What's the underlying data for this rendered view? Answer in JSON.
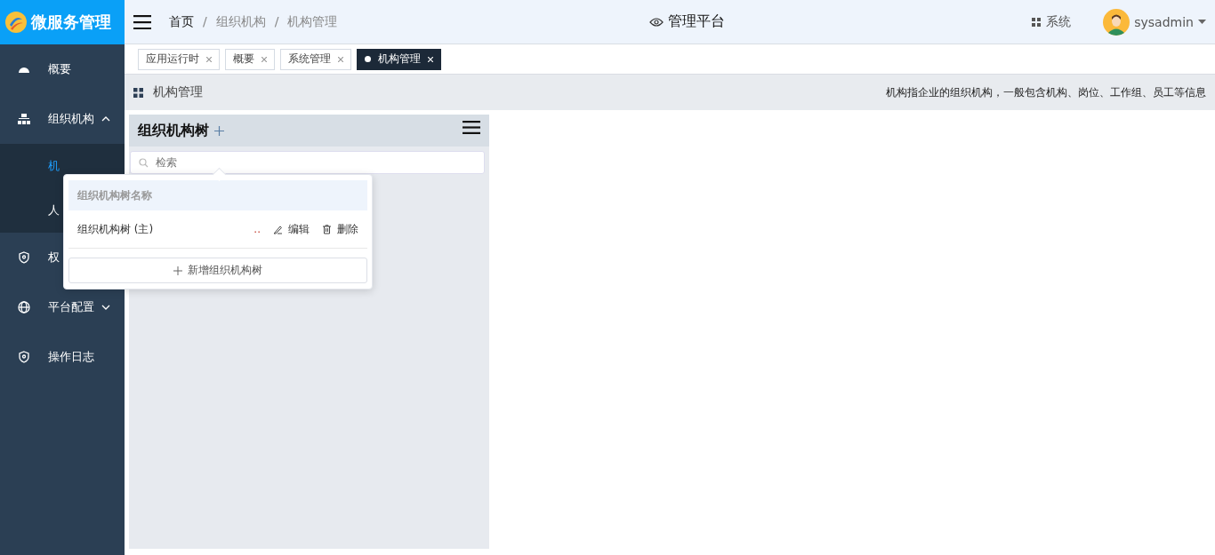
{
  "logo": {
    "title": "微服务管理"
  },
  "breadcrumb": {
    "separator": "/",
    "items": [
      {
        "label": "首页",
        "current": false
      },
      {
        "label": "组织机构",
        "current": true
      },
      {
        "label": "机构管理",
        "current": true
      }
    ]
  },
  "header": {
    "platform": "管理平台",
    "system": "系统",
    "user": "sysadmin"
  },
  "sidebar": {
    "items": [
      {
        "label": "概要"
      },
      {
        "label": "组织机构",
        "expanded": true,
        "children": [
          {
            "label": "机",
            "selected": true
          },
          {
            "label": "人",
            "selected": false
          }
        ]
      },
      {
        "label": "权"
      },
      {
        "label": "平台配置",
        "expanded": false
      },
      {
        "label": "操作日志"
      }
    ]
  },
  "tabs": [
    {
      "label": "应用运行时",
      "selected": false
    },
    {
      "label": "概要",
      "selected": false
    },
    {
      "label": "系统管理",
      "selected": false
    },
    {
      "label": "机构管理",
      "selected": true
    }
  ],
  "page": {
    "title": "机构管理",
    "description": "机构指企业的组织机构，一般包含机构、岗位、工作组、员工等信息"
  },
  "tree_panel": {
    "title": "组织机构树",
    "search_placeholder": "检索"
  },
  "popover": {
    "column": "组织机构树名称",
    "rows": [
      {
        "name": "组织机构树 (主)",
        "more": "..",
        "edit": "编辑",
        "delete": "删除"
      }
    ],
    "add_button": "新增组织机构树"
  }
}
